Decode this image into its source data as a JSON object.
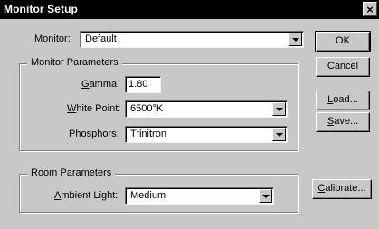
{
  "window": {
    "title": "Monitor Setup",
    "close_glyph": "×"
  },
  "monitor": {
    "label": "Monitor:",
    "value": "Default"
  },
  "monitor_parameters": {
    "legend": "Monitor Parameters",
    "gamma": {
      "label": "Gamma:",
      "value": "1.80"
    },
    "white_point": {
      "label": "White Point:",
      "value": "6500°K"
    },
    "phosphors": {
      "label": "Phosphors:",
      "value": "Trinitron"
    }
  },
  "room_parameters": {
    "legend": "Room Parameters",
    "ambient_light": {
      "label": "Ambient Light:",
      "value": "Medium"
    }
  },
  "buttons": {
    "ok": "OK",
    "cancel": "Cancel",
    "load": "Load...",
    "save": "Save...",
    "calibrate": "Calibrate..."
  },
  "icons": {
    "dropdown": "chevron-down-icon",
    "close": "close-icon"
  }
}
